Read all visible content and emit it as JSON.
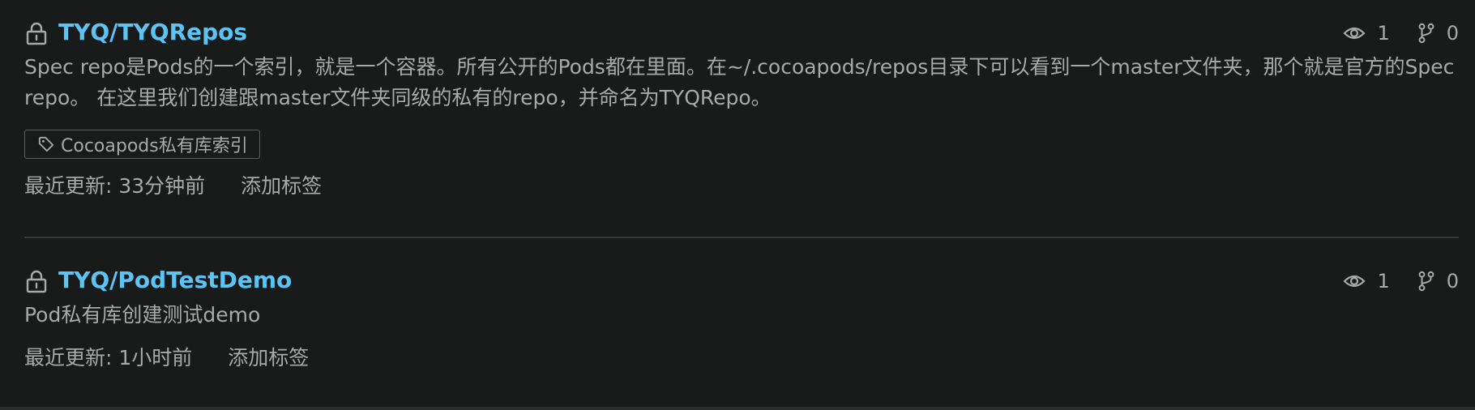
{
  "repos": [
    {
      "name": "TYQ/TYQRepos",
      "description": "Spec repo是Pods的一个索引，就是一个容器。所有公开的Pods都在里面。在~/.cocoapods/repos目录下可以看到一个master文件夹，那个就是官方的Spec repo。 在这里我们创建跟master文件夹同级的私有的repo，并命名为TYQRepo。",
      "tags": [
        "Cocoapods私有库索引"
      ],
      "watchers": "1",
      "forks": "0",
      "updated": "最近更新: 33分钟前",
      "add_tag": "添加标签"
    },
    {
      "name": "TYQ/PodTestDemo",
      "description": "Pod私有库创建测试demo",
      "tags": [],
      "watchers": "1",
      "forks": "0",
      "updated": "最近更新: 1小时前",
      "add_tag": "添加标签"
    }
  ],
  "icons": {
    "lock": "lock-icon",
    "watchers": "eye-icon",
    "forks": "fork-icon",
    "tag": "tag-icon"
  },
  "colors": {
    "background": "#191b1b",
    "link": "#5cc3f3",
    "text": "#a9a9a9",
    "border": "#5b5d5d"
  }
}
